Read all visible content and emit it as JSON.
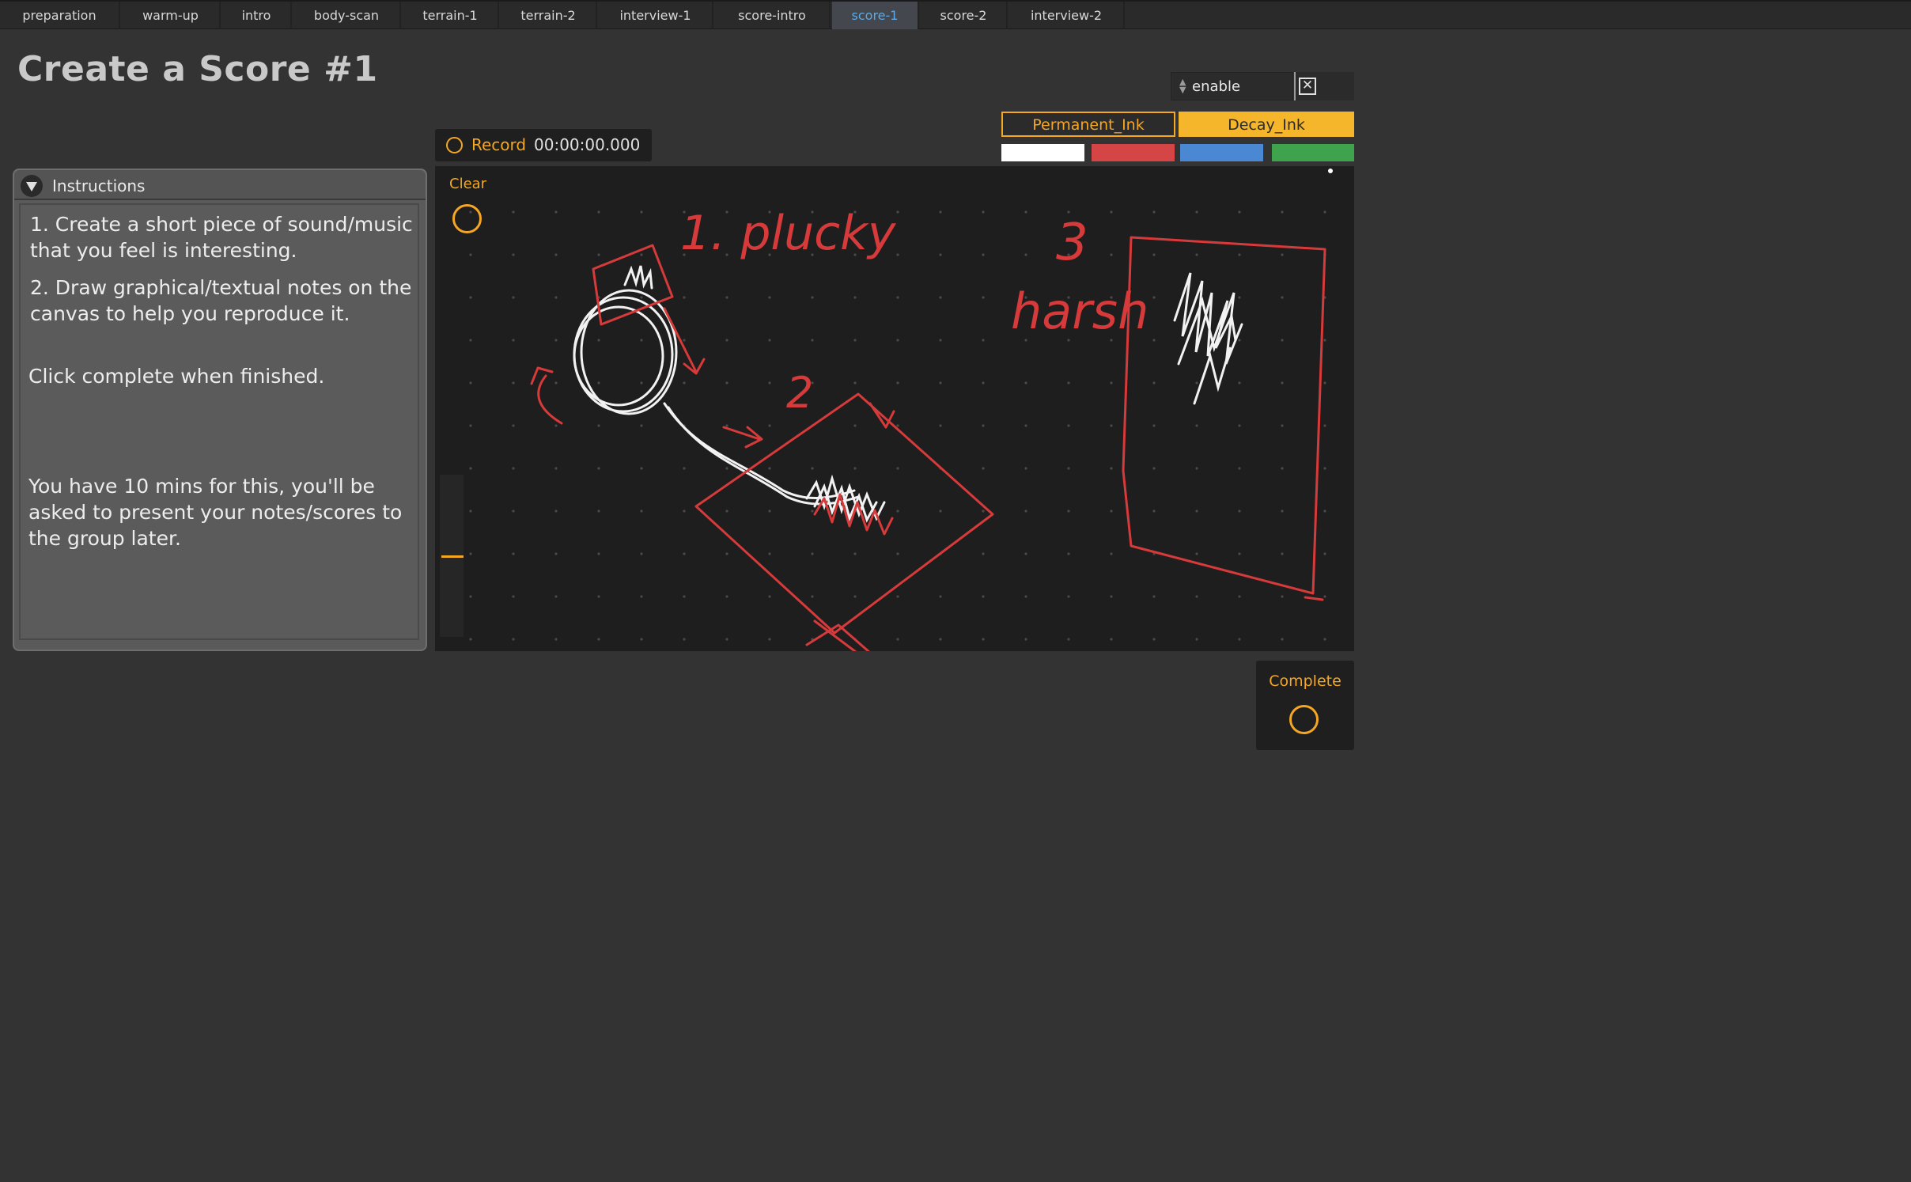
{
  "tabs": [
    {
      "label": "preparation",
      "active": false
    },
    {
      "label": "warm-up",
      "active": false
    },
    {
      "label": "intro",
      "active": false
    },
    {
      "label": "body-scan",
      "active": false
    },
    {
      "label": "terrain-1",
      "active": false
    },
    {
      "label": "terrain-2",
      "active": false
    },
    {
      "label": "interview-1",
      "active": false
    },
    {
      "label": "score-intro",
      "active": false
    },
    {
      "label": "score-1",
      "active": true
    },
    {
      "label": "score-2",
      "active": false
    },
    {
      "label": "interview-2",
      "active": false
    }
  ],
  "page": {
    "title": "Create a Score #1"
  },
  "enable": {
    "label": "enable",
    "checked": true
  },
  "ink": {
    "permanent_label": "Permanent_Ink",
    "decay_label": "Decay_Ink"
  },
  "colors": {
    "accent": "#f5a623",
    "swatches": [
      "#ffffff",
      "#d64545",
      "#4a88d4",
      "#3fa34d"
    ]
  },
  "record": {
    "label": "Record",
    "time": "00:00:00.000"
  },
  "instructions": {
    "title": "Instructions",
    "step1": "1. Create a short piece of sound/music that you feel is interesting.",
    "step2": "2. Draw graphical/textual notes on the canvas to help you reproduce it.",
    "complete_note": "Click complete when finished.",
    "time_note": "You have 10 mins for this, you'll be asked to present your notes/scores to the group later."
  },
  "canvas": {
    "clear_label": "Clear",
    "annotations": [
      "1. plucky",
      "2",
      "3",
      "harsh"
    ]
  },
  "complete": {
    "label": "Complete"
  }
}
